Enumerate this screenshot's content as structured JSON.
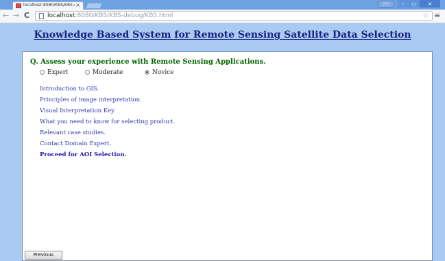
{
  "browser": {
    "tab_title": "localhost:8080/KBS/KBS-deb",
    "tab_close": "×",
    "user_button": "???",
    "window_min": "–",
    "window_max": "▭",
    "window_close": "×",
    "nav_back": "←",
    "nav_forward": "→",
    "reload": "C",
    "url_host": "localhost",
    "url_rest": ":8080/KBS/KBS-debug/KBS.html",
    "star": "☆",
    "menu": "≡"
  },
  "page": {
    "heading": "Knowledge Based System for Remote Sensing Satellite Data Selection",
    "question": "Q. Assess your experience with Remote Sensing Applications.",
    "options": [
      {
        "label": "Expert",
        "checked": false
      },
      {
        "label": "Moderate",
        "checked": false
      },
      {
        "label": "Novice",
        "checked": true
      }
    ],
    "links": [
      "Introduction to GIS.",
      "Principles of image interpretation.",
      "Visual Interpretation Key.",
      "What you need to know for selecting product.",
      "Relevant case studies.",
      "Contact Domain Expert.",
      "Proceed for AOI Selection."
    ],
    "previous_button": "Previous"
  }
}
